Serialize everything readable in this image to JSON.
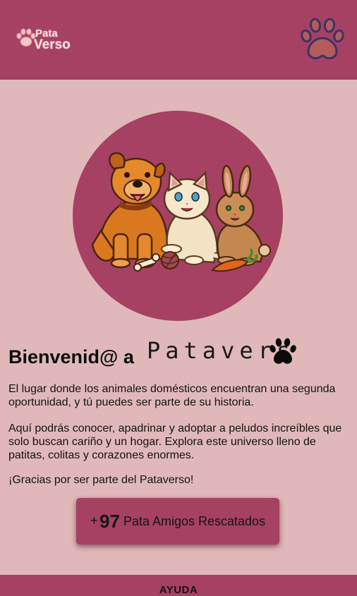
{
  "header": {
    "logo_line1": "Pata",
    "logo_line2": "Verso",
    "paw_icon": "paw-icon"
  },
  "hero": {
    "image": "dog-cat-rabbit-illustration"
  },
  "welcome": {
    "title": "Bienvenid@ a",
    "brand": "Patavers",
    "brand_icon": "paw-icon"
  },
  "paragraphs": {
    "p1": "El lugar donde los animales domésticos encuentran una segunda oportunidad, y tú puedes ser parte de su historia.",
    "p2": "Aquí podrás conocer, apadrinar y adoptar a peludos increíbles que solo buscan cariño y un hogar. Explora este universo lleno de patitas, colitas y corazones enormes.",
    "p3": "¡Gracias por ser parte del Pataverso!"
  },
  "stats": {
    "plus": "+",
    "count": "97",
    "label": "Pata Amigos Rescatados"
  },
  "footer": {
    "help_link": "AYUDA"
  },
  "colors": {
    "primary": "#a64163",
    "background": "#e0b8b9"
  }
}
